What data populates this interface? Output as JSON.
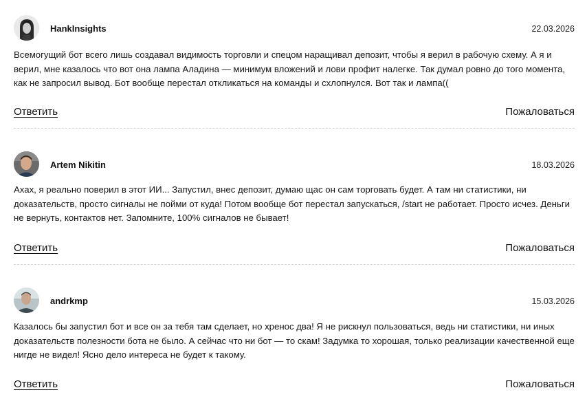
{
  "comments": [
    {
      "author": "HankInsights",
      "date": "22.03.2026",
      "text": "Всемогущий бот всего лишь создавал видимость торговли и спецом наращивал депозит, чтобы я верил в рабочую схему. А я и верил, мне казалось что вот она лампа Аладина — минимум вложений и лови профит налегке. Так думал ровно до того момента, как не запросил вывод. Бот вообще перестал откликаться на команды и схлопнулся. Вот так и лампа((",
      "reply_label": "Ответить",
      "report_label": "Пожаловаться"
    },
    {
      "author": "Artem Nikitin",
      "date": "18.03.2026",
      "text": "Ахах, я реально поверил в этот ИИ... Запустил, внес депозит, думаю щас он сам торговать будет. А там ни статистики, ни доказательств, просто сигналы не пойми от куда! Потом вообще бот перестал запускаться, /start не работает. Просто исчез. Деньги не вернуть, контактов нет. Запомните, 100% сигналов не бывает!",
      "reply_label": "Ответить",
      "report_label": "Пожаловаться"
    },
    {
      "author": "andrkmp",
      "date": "15.03.2026",
      "text": "Казалось бы запустил бот и все он за тебя там сделает, но хренос два! Я не рискнул пользоваться, ведь ни статистики, ни иных доказательств полезности бота не было. А сейчас что ни бот — то скам! Задумка то хорошая, только реализации качественной еще нигде не видел! Ясно дело интереса не будет к такому.",
      "reply_label": "Ответить",
      "report_label": "Пожаловаться"
    }
  ],
  "colors": {
    "text": "#111111",
    "divider": "#d6d6d6",
    "background": "#ffffff"
  },
  "icons": {
    "avatar_1": "user-photo-avatar",
    "avatar_2": "user-photo-avatar",
    "avatar_3": "user-photo-avatar"
  }
}
